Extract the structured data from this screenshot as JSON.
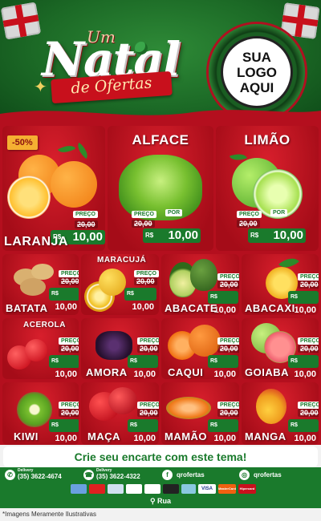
{
  "header": {
    "title_um": "Um",
    "title_natal": "Natal",
    "title_ofertas": "de Ofertas",
    "logo_placeholder": "SUA\nLOGO\nAQUI"
  },
  "price_labels": {
    "from": "PREÇO",
    "to": "POR",
    "currency": "R$"
  },
  "featured": [
    {
      "name": "LARANJA",
      "old_price": "20,00",
      "new_price": "10,00",
      "badge": "-50%"
    },
    {
      "name": "ALFACE",
      "old_price": "20,00",
      "new_price": "10,00"
    },
    {
      "name": "LIMÃO",
      "old_price": "20,00",
      "new_price": "10,00"
    }
  ],
  "products": [
    {
      "name": "BATATA",
      "old_price": "20,00",
      "new_price": "10,00"
    },
    {
      "name": "MARACUJÁ",
      "old_price": "20,00",
      "new_price": "10,00"
    },
    {
      "name": "ABACATE",
      "old_price": "20,00",
      "new_price": "10,00"
    },
    {
      "name": "ABACAXI",
      "old_price": "20,00",
      "new_price": "10,00"
    },
    {
      "name": "ACEROLA",
      "old_price": "20,00",
      "new_price": "10,00"
    },
    {
      "name": "AMORA",
      "old_price": "20,00",
      "new_price": "10,00"
    },
    {
      "name": "CAQUI",
      "old_price": "20,00",
      "new_price": "10,00"
    },
    {
      "name": "GOIABA",
      "old_price": "20,00",
      "new_price": "10,00"
    },
    {
      "name": "KIWI",
      "old_price": "20,00",
      "new_price": "10,00"
    },
    {
      "name": "MAÇA",
      "old_price": "20,00",
      "new_price": "10,00"
    },
    {
      "name": "MAMÃO",
      "old_price": "20,00",
      "new_price": "10,00"
    },
    {
      "name": "MANGA",
      "old_price": "20,00",
      "new_price": "10,00"
    }
  ],
  "cta": "Crie seu encarte com este tema!",
  "contacts": {
    "delivery_label": "Delivery",
    "whatsapp": "(35) 3622-4674",
    "phone": "(35) 3622-4322",
    "facebook": "qrofertas",
    "instagram": "qrofertas"
  },
  "payments": [
    "",
    "",
    "",
    "",
    "",
    "",
    "",
    "VISA",
    "MasterCard",
    "Hipercard"
  ],
  "address": "Rua",
  "disclaimer": "*Imagens Meramente Ilustrativas",
  "colors": {
    "brand_red": "#c8101c",
    "brand_green": "#1a7a2c",
    "header_green": "#1c6a26",
    "badge_orange": "#f5b032"
  }
}
